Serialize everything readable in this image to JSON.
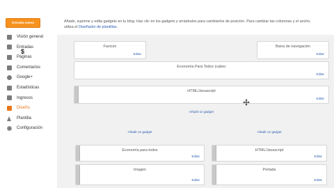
{
  "sidebar": {
    "new_post": "Entrada nueva",
    "items": [
      {
        "label": "Visión general",
        "icon": "overview-icon"
      },
      {
        "label": "Entradas",
        "icon": "posts-icon"
      },
      {
        "label": "Páginas",
        "icon": "pages-icon"
      },
      {
        "label": "Comentarios",
        "icon": "comments-icon"
      },
      {
        "label": "Google+",
        "icon": "google-plus-icon"
      },
      {
        "label": "Estadísticas",
        "icon": "stats-icon"
      },
      {
        "label": "Ingresos",
        "icon": "earnings-icon"
      },
      {
        "label": "Diseño",
        "icon": "layout-icon",
        "active": true
      },
      {
        "label": "Plantilla",
        "icon": "template-icon"
      },
      {
        "label": "Configuración",
        "icon": "settings-icon"
      }
    ]
  },
  "intro": {
    "text": "Añade, suprime y edita gadgets en tu blog. Haz clic en los gadgets y arrástralos para cambiarlos de posición. Para cambiar las columnas y el ancho, utiliza el",
    "link": "Diseñador de plantillas"
  },
  "layout": {
    "favicon": {
      "title": "Favicon",
      "edit": "Editar"
    },
    "navbar": {
      "title": "Barra de navegación",
      "edit": "Editar"
    },
    "header": {
      "title": "Economía Para Todos (cabec",
      "edit": "Editar"
    },
    "html_main": {
      "title": "HTML/Javascript",
      "edit": "Editar"
    },
    "add_gadget_main": "Añadir un gadget",
    "add_gadget_left": "Añadir un gadget",
    "add_gadget_right": "Añadir un gadget",
    "left_col": [
      {
        "title": "Economía para todos",
        "edit": "Editar"
      },
      {
        "title": "Imagen",
        "edit": "Editar"
      }
    ],
    "right_col": [
      {
        "title": "HTML/Javascript",
        "edit": "Editar"
      },
      {
        "title": "Portada",
        "edit": "Editar"
      }
    ]
  },
  "colors": {
    "accent": "#f6921e",
    "active_nav": "#e8751a",
    "link": "#2a5db0"
  }
}
